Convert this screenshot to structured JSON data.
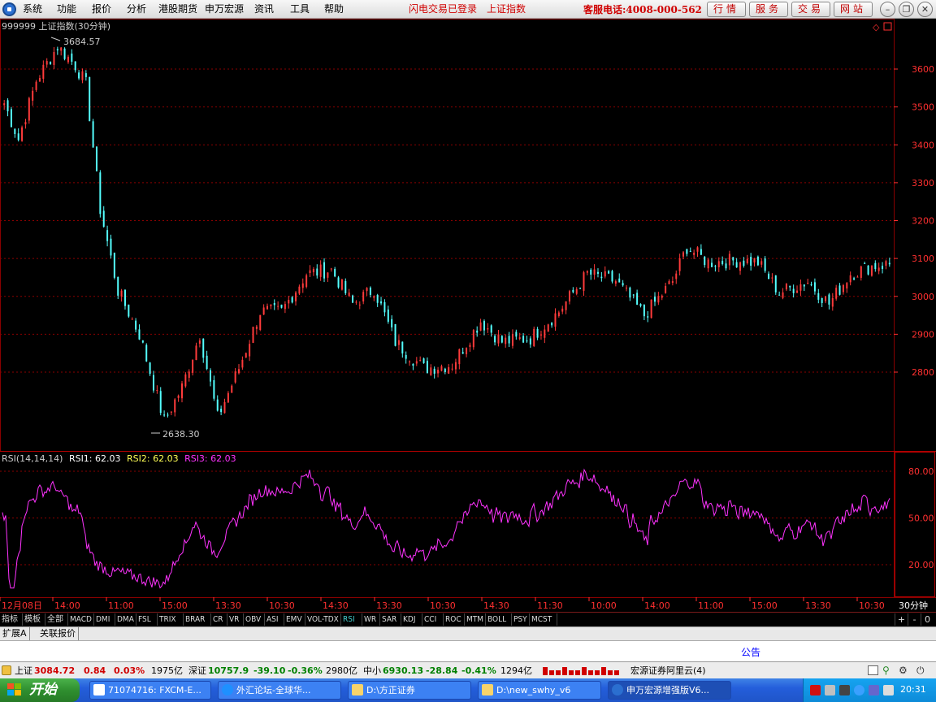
{
  "menu": {
    "items": [
      "系统",
      "功能",
      "报价",
      "分析",
      "港股期货",
      "申万宏源",
      "资讯",
      "工具",
      "帮助"
    ],
    "status_login": "闪电交易已登录",
    "status_index": "上证指数",
    "hotline": "客服电话:4008-000-562",
    "buttons": [
      "行情",
      "服务",
      "交易",
      "网站"
    ]
  },
  "chart": {
    "title": "999999 上证指数(30分钟)",
    "high_label": "3684.57",
    "low_label": "2638.30",
    "price_ticks": [
      "3600",
      "3500",
      "3400",
      "3300",
      "3200",
      "3100",
      "3000",
      "2900",
      "2800"
    ],
    "rsi_header": {
      "name": "RSI(14,14,14)",
      "rsi1": "RSI1: 62.03",
      "rsi2": "RSI2: 62.03",
      "rsi3": "RSI3: 62.03"
    },
    "rsi_ticks": [
      "80.00",
      "50.00",
      "20.00"
    ],
    "time_labels": [
      "12月08日",
      "14:00",
      "11:00",
      "15:00",
      "13:30",
      "10:30",
      "14:30",
      "13:30",
      "10:30",
      "14:30",
      "11:30",
      "10:00",
      "14:00",
      "11:00",
      "15:00",
      "13:30",
      "10:30"
    ],
    "period_label": "30分钟",
    "colors": {
      "up": "#ff3b3b",
      "down": "#54ffff",
      "rsi": "#ff33ff",
      "grid": "#8a0000",
      "axis_text": "#ff3030"
    }
  },
  "chart_data": {
    "type": "line",
    "title": "999999 上证指数(30分钟)",
    "price_range": [
      2600,
      3700
    ],
    "price_key_points": [
      {
        "i": 0,
        "v": 3510
      },
      {
        "i": 4,
        "v": 3415
      },
      {
        "i": 9,
        "v": 3570
      },
      {
        "i": 15,
        "v": 3660
      },
      {
        "i": 20,
        "v": 3610
      },
      {
        "i": 23,
        "v": 3560
      },
      {
        "i": 27,
        "v": 3230
      },
      {
        "i": 32,
        "v": 3015
      },
      {
        "i": 38,
        "v": 2900
      },
      {
        "i": 45,
        "v": 2670
      },
      {
        "i": 50,
        "v": 2760
      },
      {
        "i": 55,
        "v": 2900
      },
      {
        "i": 60,
        "v": 2680
      },
      {
        "i": 66,
        "v": 2810
      },
      {
        "i": 72,
        "v": 2960
      },
      {
        "i": 78,
        "v": 2960
      },
      {
        "i": 85,
        "v": 3060
      },
      {
        "i": 92,
        "v": 3070
      },
      {
        "i": 98,
        "v": 2980
      },
      {
        "i": 104,
        "v": 3020
      },
      {
        "i": 110,
        "v": 2880
      },
      {
        "i": 118,
        "v": 2810
      },
      {
        "i": 126,
        "v": 2820
      },
      {
        "i": 134,
        "v": 2935
      },
      {
        "i": 140,
        "v": 2880
      },
      {
        "i": 148,
        "v": 2890
      },
      {
        "i": 156,
        "v": 2960
      },
      {
        "i": 164,
        "v": 3060
      },
      {
        "i": 172,
        "v": 3040
      },
      {
        "i": 180,
        "v": 2950
      },
      {
        "i": 188,
        "v": 3040
      },
      {
        "i": 192,
        "v": 3130
      },
      {
        "i": 198,
        "v": 3090
      },
      {
        "i": 206,
        "v": 3095
      },
      {
        "i": 212,
        "v": 3090
      },
      {
        "i": 218,
        "v": 3010
      },
      {
        "i": 226,
        "v": 3040
      },
      {
        "i": 232,
        "v": 2980
      },
      {
        "i": 238,
        "v": 3060
      },
      {
        "i": 244,
        "v": 3080
      },
      {
        "i": 249,
        "v": 3085
      }
    ],
    "rsi_range": [
      0,
      100
    ],
    "rsi_last": 62.03,
    "high": 3684.57,
    "low": 2638.3
  },
  "tabs": {
    "indicators": [
      "指标",
      "模板",
      "全部",
      "MACD",
      "DMI",
      "DMA",
      "FSL",
      "TRIX",
      "BRAR",
      "CR",
      "VR",
      "OBV",
      "ASI",
      "EMV",
      "VOL-TDX",
      "RSI",
      "WR",
      "SAR",
      "KDJ",
      "CCI",
      "ROC",
      "MTM",
      "BOLL",
      "PSY",
      "MCST"
    ],
    "active": "RSI",
    "plus": "+",
    "minus": "-",
    "zero": "0",
    "sub_tabs": [
      "扩展A",
      "关联报价"
    ]
  },
  "notice": "公告",
  "status": {
    "sh_name": "上证",
    "sh_value": "3084.72",
    "sh_change": "0.84",
    "sh_pct": "0.03%",
    "sh_amount": "1975亿",
    "sz_name": "深证",
    "sz_value": "10757.9",
    "sz_change": "-39.10",
    "sz_pct": "-0.36%",
    "sz_amount": "2980亿",
    "zx_name": "中小",
    "zx_value": "6930.13",
    "zx_change": "-28.84",
    "zx_pct": "-0.41%",
    "zx_amount": "1294亿",
    "server": "宏源证券阿里云(4)"
  },
  "taskbar": {
    "start": "开始",
    "items": [
      "71074716: FXCM-E...",
      "外汇论坛-全球华...",
      "D:\\方正证券",
      "D:\\new_swhy_v6",
      "申万宏源增强版V6..."
    ],
    "clock": "20:31"
  }
}
